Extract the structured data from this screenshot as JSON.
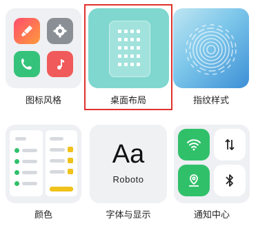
{
  "tiles": [
    {
      "label": "图标风格"
    },
    {
      "label": "桌面布局"
    },
    {
      "label": "指纹样式"
    },
    {
      "label": "颜色"
    },
    {
      "label": "字体与显示"
    },
    {
      "label": "通知中心"
    }
  ],
  "font_preview": {
    "big": "Aa",
    "name": "Roboto"
  },
  "selected_tile": "桌面布局",
  "colors": {
    "selection_border": "#e0302b",
    "layout_bg": "#7fd7cf",
    "accent_green": "#31c06a",
    "accent_yellow": "#f0c21a"
  },
  "icons": [
    "paint-brush-icon",
    "gear-icon",
    "phone-icon",
    "music-note-icon",
    "grid-icon",
    "fingerprint-icon",
    "wifi-icon",
    "data-arrows-icon",
    "location-pin-icon",
    "bluetooth-icon"
  ]
}
